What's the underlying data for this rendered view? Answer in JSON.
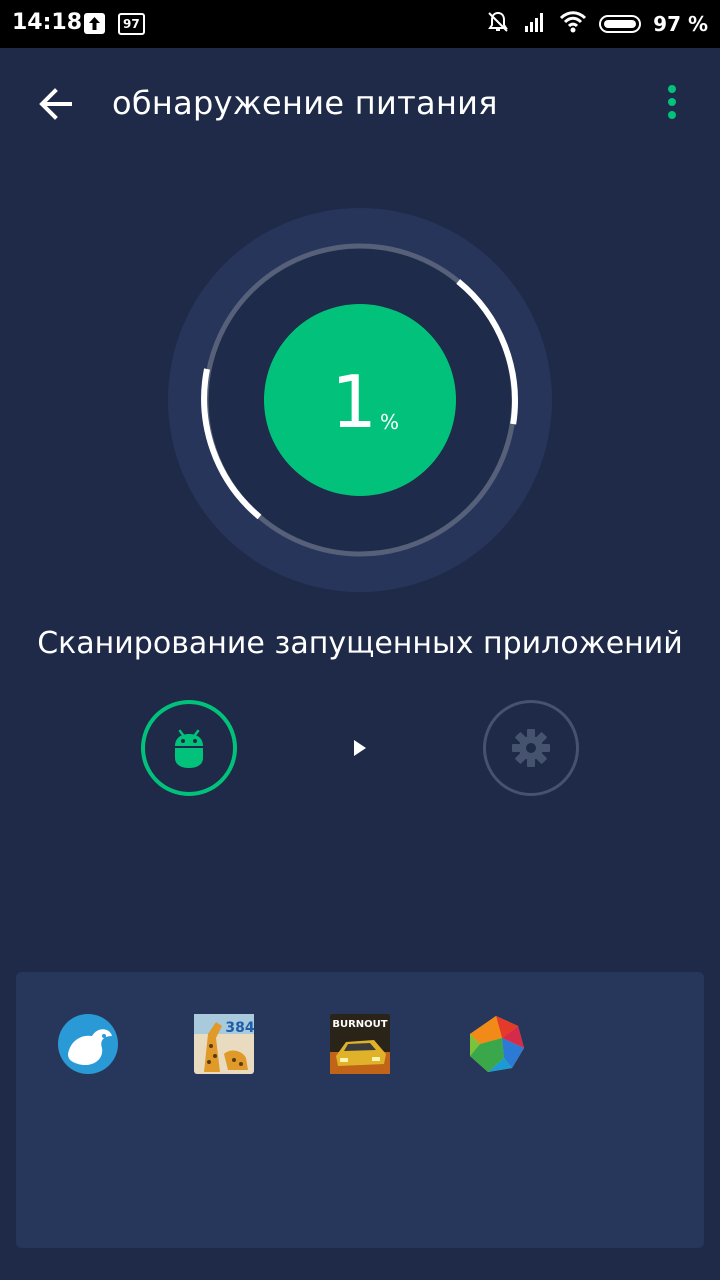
{
  "status_bar": {
    "time": "14:18",
    "battery_badge": "97",
    "battery_percent": "97 %",
    "icons": [
      "upload-icon",
      "battery-badge-icon",
      "notifications-muted-icon",
      "signal-icon",
      "wifi-icon",
      "battery-icon"
    ]
  },
  "app_bar": {
    "title": "обнаружение питания",
    "back_icon": "arrow-left-icon",
    "menu_icon": "more-vert-icon",
    "accent_color": "#02c27b"
  },
  "progress": {
    "value": "1",
    "unit": "%",
    "ring_color": "#ffffff",
    "center_color": "#02c27b"
  },
  "scan": {
    "label": "Сканирование запущенных приложений",
    "steps": [
      {
        "icon": "android-icon",
        "state": "active"
      },
      {
        "icon": "play-arrow-icon",
        "state": "separator"
      },
      {
        "icon": "gear-icon",
        "state": "pending"
      }
    ]
  },
  "apps": {
    "icons": [
      "kiwi-browser-icon",
      "puzzle-384-icon",
      "burnout-game-icon",
      "colorful-globe-icon"
    ]
  },
  "colors": {
    "background": "#1e2a48",
    "panel": "#27375c",
    "status_bar": "#000000",
    "accent": "#02c27b"
  }
}
